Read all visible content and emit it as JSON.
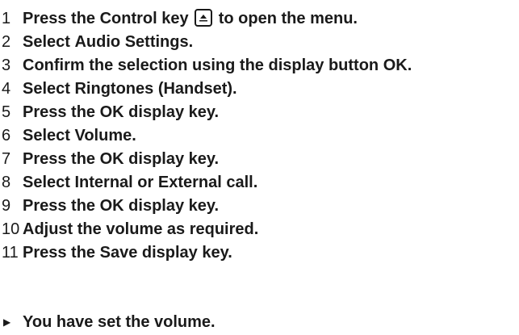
{
  "steps": [
    {
      "num": "1",
      "pre": "Press the Control key ",
      "icon": "up-arrow-key-icon",
      "post": " to open the menu."
    },
    {
      "num": "2",
      "pre": "Select ",
      "bold": "Audio Settings",
      "post": "."
    },
    {
      "num": "3",
      "pre": "Confirm the selection using the display button ",
      "bold": "OK",
      "post": "."
    },
    {
      "num": "4",
      "pre": "Select ",
      "bold": "Ringtones (Handset)",
      "post": "."
    },
    {
      "num": "5",
      "pre": "Press the ",
      "bold": "OK",
      "post": " display key."
    },
    {
      "num": "6",
      "pre": "Select ",
      "bold": "Volume",
      "post": "."
    },
    {
      "num": "7",
      "pre": "Press the ",
      "bold": "OK",
      "post": " display key."
    },
    {
      "num": "8",
      "pre": "Select ",
      "bold": "Internal",
      "mid": " or ",
      "bold2": "External call",
      "post": "."
    },
    {
      "num": "9",
      "pre": "Press the ",
      "bold": "OK",
      "post": " display key."
    },
    {
      "num": "10",
      "pre": "Adjust the volume as required."
    },
    {
      "num": "11",
      "pre": "Press the ",
      "bold": "Save",
      "post": " display key."
    }
  ],
  "result": {
    "icon": "result-arrow-icon",
    "text": "You have set the volume."
  }
}
